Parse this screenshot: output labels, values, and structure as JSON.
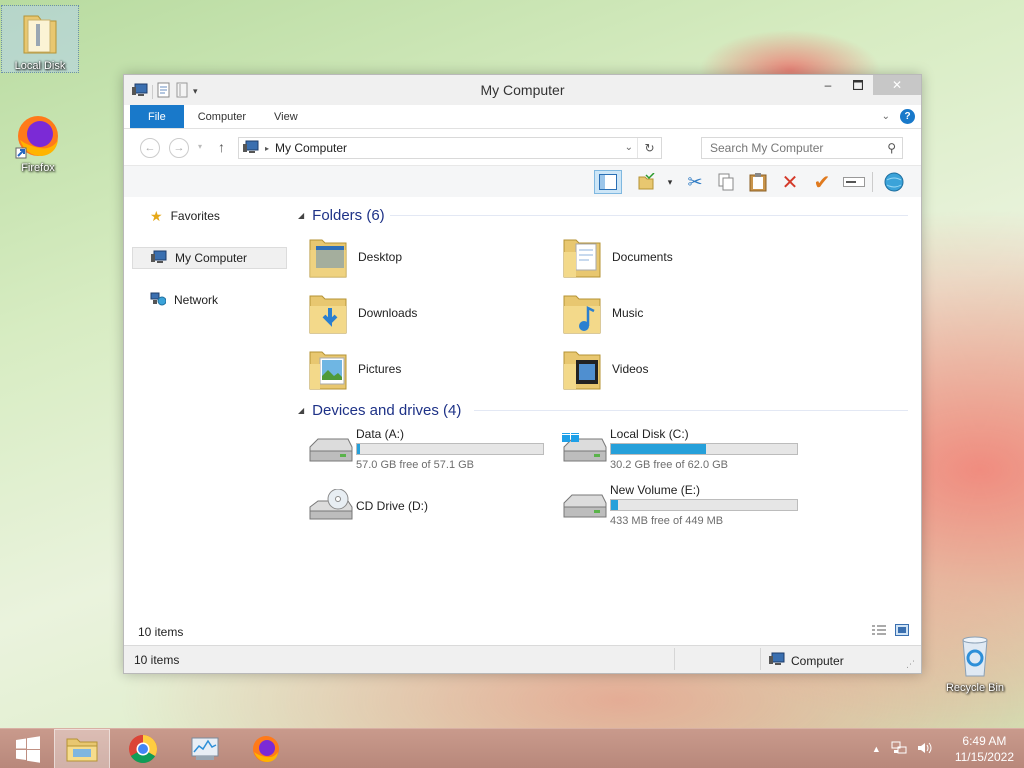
{
  "desktop": {
    "icons": [
      {
        "label": "Local Disk"
      },
      {
        "label": "Firefox"
      },
      {
        "label": "Recycle Bin"
      }
    ]
  },
  "window": {
    "title": "My Computer",
    "tabs": {
      "file": "File",
      "computer": "Computer",
      "view": "View"
    },
    "help": "?",
    "address": "My Computer",
    "search_placeholder": "Search My Computer",
    "nav": {
      "favorites": "Favorites",
      "my_computer": "My Computer",
      "network": "Network"
    },
    "folders_header": "Folders (6)",
    "folders": [
      {
        "name": "Desktop"
      },
      {
        "name": "Documents"
      },
      {
        "name": "Downloads"
      },
      {
        "name": "Music"
      },
      {
        "name": "Pictures"
      },
      {
        "name": "Videos"
      }
    ],
    "drives_header": "Devices and drives (4)",
    "drives": [
      {
        "name": "Data (A:)",
        "free": "57.0 GB free of 57.1 GB",
        "used_fraction": 0.002
      },
      {
        "name": "Local Disk (C:)",
        "free": "30.2 GB free of 62.0 GB",
        "used_fraction": 0.51
      },
      {
        "name": "CD Drive (D:)",
        "free": "",
        "used_fraction": null
      },
      {
        "name": "New Volume (E:)",
        "free": "433 MB free of 449 MB",
        "used_fraction": 0.036
      }
    ],
    "content_count": "10 items",
    "status_count": "10 items",
    "status_location": "Computer"
  },
  "taskbar": {
    "time": "6:49 AM",
    "date": "11/15/2022"
  },
  "colors": {
    "accent": "#1979ca",
    "drive_bar": "#26a0da",
    "group_header": "#1e3287"
  }
}
